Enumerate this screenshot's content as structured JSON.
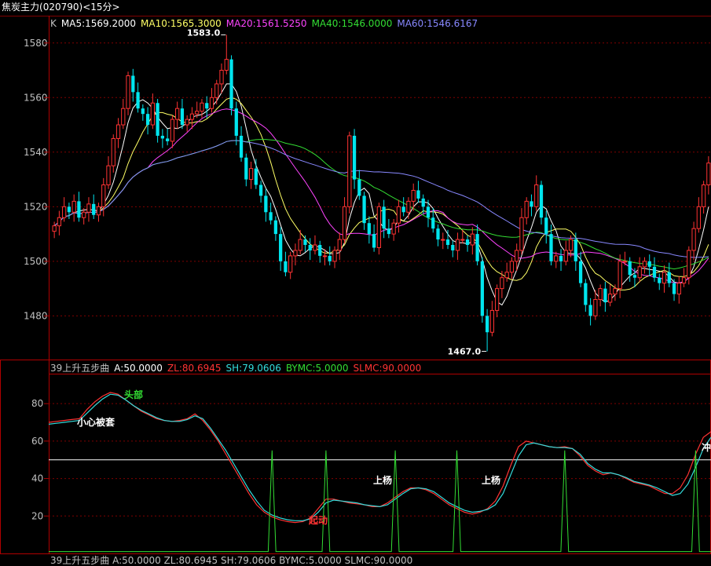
{
  "window": {
    "title": "焦炭主力",
    "code": "(020790)",
    "period": "<15分>"
  },
  "kline_legend": {
    "prefix": "K",
    "items": [
      {
        "label": "MA5:1569.2000",
        "color": "#ffffff"
      },
      {
        "label": "MA10:1565.3000",
        "color": "#ffff66"
      },
      {
        "label": "MA20:1561.5250",
        "color": "#ff44ff"
      },
      {
        "label": "MA40:1546.0000",
        "color": "#33dd33"
      },
      {
        "label": "MA60:1546.6167",
        "color": "#8888ff"
      }
    ]
  },
  "indicator_legend": {
    "prefix": "39上升五步曲",
    "items": [
      {
        "label": "A:50.0000",
        "color": "#ffffff"
      },
      {
        "label": "ZL:80.6945",
        "color": "#ff3333"
      },
      {
        "label": "SH:79.0606",
        "color": "#33dddd"
      },
      {
        "label": "BYMC:5.0000",
        "color": "#33dd33"
      },
      {
        "label": "SLMC:90.0000",
        "color": "#ff3333"
      }
    ]
  },
  "bottom_cut_text": "39上升五步曲 A:50.0000 ZL:80.6945 SH:79.0606 BYMC:5.0000 SLMC:90.0000",
  "colors": {
    "up": "#ff3333",
    "down": "#00e5ee",
    "frame": "#b00000",
    "grid": "#800000",
    "axis_text": "#c0c0c0"
  },
  "chart_data": [
    {
      "type": "candlestick",
      "ylim": [
        1464,
        1590
      ],
      "yticks": [
        1480,
        1500,
        1520,
        1540,
        1560,
        1580
      ],
      "annotations": [
        {
          "text": "1583.0",
          "value": 1583.0
        },
        {
          "text": "1467.0",
          "value": 1467.0
        }
      ],
      "close": [
        1513,
        1516,
        1520,
        1518,
        1522,
        1516,
        1518,
        1521,
        1517,
        1520,
        1528,
        1535,
        1545,
        1550,
        1556,
        1568,
        1562,
        1556,
        1554,
        1550,
        1558,
        1546,
        1545,
        1544,
        1552,
        1556,
        1550,
        1552,
        1554,
        1555,
        1558,
        1556,
        1560,
        1565,
        1570,
        1574,
        1556,
        1546,
        1538,
        1530,
        1534,
        1528,
        1524,
        1518,
        1515,
        1510,
        1500,
        1496,
        1502,
        1504,
        1508,
        1506,
        1504,
        1506,
        1502,
        1502,
        1500,
        1504,
        1508,
        1520,
        1546,
        1530,
        1524,
        1514,
        1510,
        1505,
        1520,
        1512,
        1510,
        1514,
        1520,
        1518,
        1522,
        1526,
        1523,
        1520,
        1516,
        1512,
        1508,
        1508,
        1506,
        1504,
        1508,
        1508,
        1506,
        1510,
        1500,
        1480,
        1474,
        1482,
        1490,
        1494,
        1496,
        1500,
        1504,
        1516,
        1522,
        1520,
        1528,
        1516,
        1510,
        1500,
        1502,
        1500,
        1504,
        1508,
        1500,
        1492,
        1484,
        1480,
        1486,
        1490,
        1485,
        1488,
        1490,
        1500,
        1500,
        1495,
        1494,
        1498,
        1500,
        1498,
        1494,
        1492,
        1496,
        1492,
        1488,
        1492,
        1494,
        1504,
        1512,
        1520,
        1528,
        1536
      ],
      "moving_averages": [
        "MA5",
        "MA10",
        "MA20",
        "MA40",
        "MA60"
      ]
    },
    {
      "type": "line",
      "ylim": [
        0,
        96
      ],
      "yticks": [
        20,
        40,
        60,
        80
      ],
      "series": [
        {
          "name": "A",
          "values": [
            50
          ]
        },
        {
          "name": "ZL",
          "values": [
            70,
            70.5,
            71,
            71.5,
            72,
            77,
            81,
            84,
            86,
            85,
            82,
            79,
            76,
            74,
            72,
            71,
            70.5,
            71,
            72,
            74.5,
            71,
            66,
            60,
            53,
            46,
            39,
            32,
            26,
            22,
            19.5,
            18,
            17,
            16.5,
            17,
            19,
            24,
            29,
            29,
            28,
            27,
            26.5,
            26,
            25,
            25,
            27,
            30,
            33,
            35,
            35,
            34,
            32,
            29,
            26,
            24,
            22,
            21,
            22,
            24,
            28,
            36,
            47,
            57,
            60,
            59,
            58,
            57,
            56.5,
            57,
            56,
            52,
            47,
            44,
            42,
            43,
            42,
            40,
            38,
            37,
            36,
            34,
            32,
            32,
            35,
            42,
            53,
            62,
            65
          ]
        },
        {
          "name": "SH",
          "values": [
            69,
            69.5,
            70,
            70.5,
            71,
            75,
            79,
            82.5,
            85,
            84.5,
            82,
            79,
            76.5,
            74.5,
            72.5,
            71,
            70.5,
            70.5,
            71.5,
            73.5,
            72,
            67,
            61,
            55,
            48,
            41,
            34,
            28,
            23,
            20.5,
            19,
            18,
            17.5,
            17.5,
            18.5,
            22,
            27,
            28.5,
            28,
            27.5,
            27,
            26,
            25.5,
            25,
            26,
            29,
            32,
            34.5,
            35,
            34.5,
            33,
            30,
            27,
            25,
            23,
            22,
            22.5,
            23.5,
            26,
            32,
            42,
            52,
            58,
            59,
            58,
            57,
            56.5,
            56.5,
            56,
            53,
            48,
            45,
            43,
            43,
            42,
            40.5,
            38.5,
            37.5,
            36.5,
            35,
            33,
            31,
            32,
            37,
            46,
            56,
            62
          ]
        },
        {
          "name": "BYMC",
          "spike_value": 55,
          "base_value": 1,
          "spike_positions": [
            29,
            36,
            45,
            53,
            67,
            84
          ]
        }
      ],
      "annotations": [
        {
          "text": "头部",
          "color": "#33dd33"
        },
        {
          "text": "小心被套",
          "color": "#ffffff"
        },
        {
          "text": "起动",
          "color": "#ff3333"
        },
        {
          "text": "上杨",
          "color": "#ffffff"
        },
        {
          "text": "上杨",
          "color": "#ffffff"
        },
        {
          "text": "冲",
          "color": "#ffffff"
        }
      ]
    }
  ]
}
